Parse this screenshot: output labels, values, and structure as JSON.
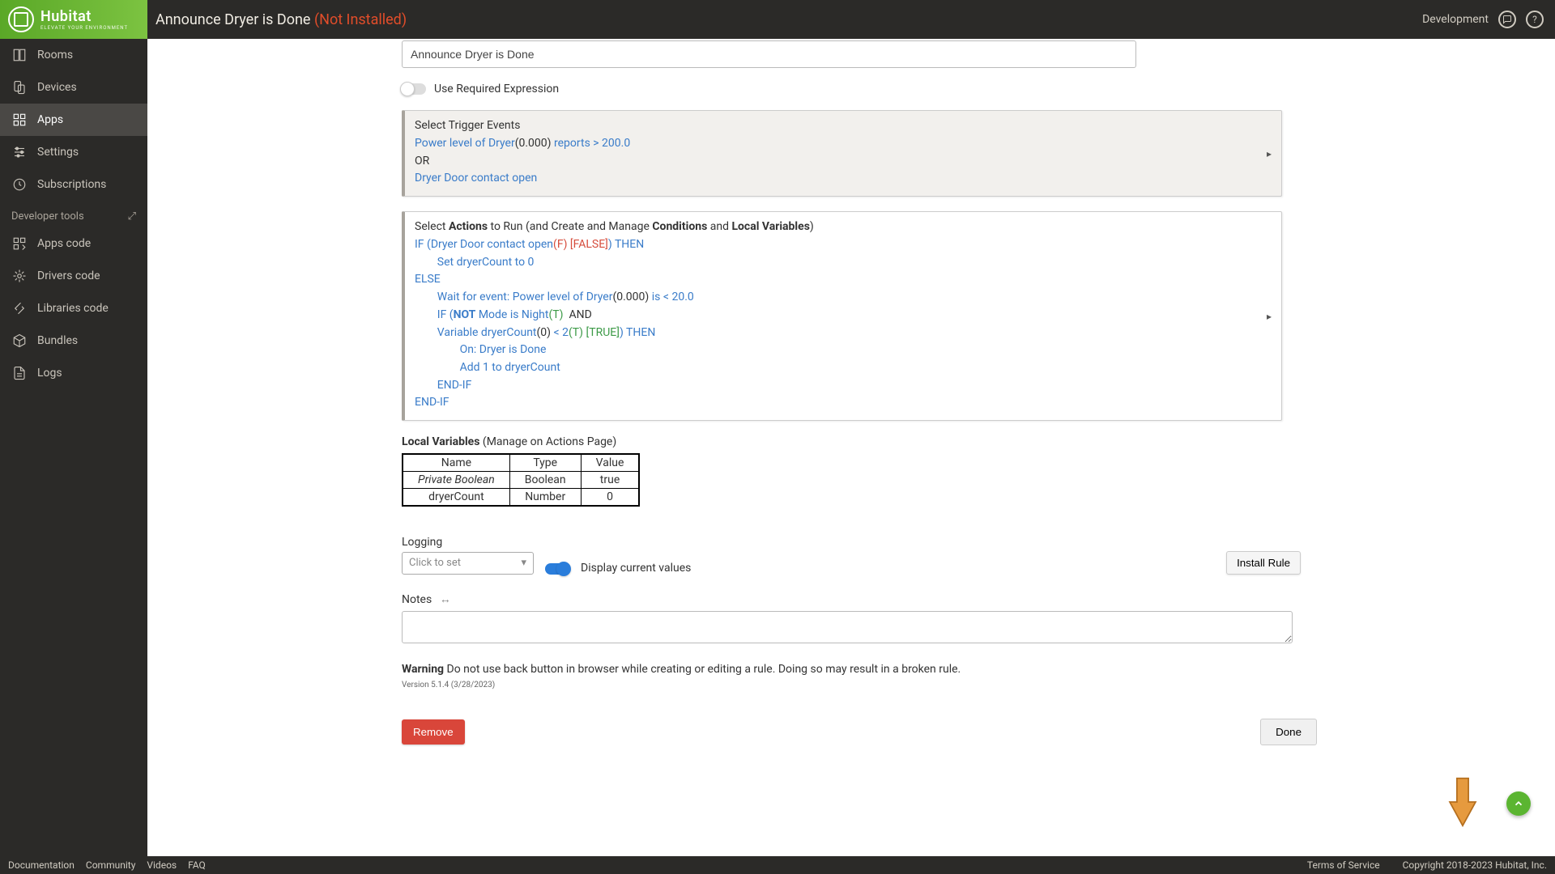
{
  "header": {
    "title": "Announce Dryer is Done",
    "status": "(Not Installed)",
    "env_label": "Development"
  },
  "logo": {
    "brand": "Hubitat",
    "tagline": "ELEVATE YOUR ENVIRONMENT"
  },
  "sidebar": {
    "items": [
      {
        "label": "Rooms",
        "icon": "rooms"
      },
      {
        "label": "Devices",
        "icon": "devices"
      },
      {
        "label": "Apps",
        "icon": "apps",
        "active": true
      },
      {
        "label": "Settings",
        "icon": "settings"
      },
      {
        "label": "Subscriptions",
        "icon": "subscriptions"
      }
    ],
    "dev_section": "Developer tools",
    "dev_items": [
      {
        "label": "Apps code"
      },
      {
        "label": "Drivers code"
      },
      {
        "label": "Libraries code"
      },
      {
        "label": "Bundles"
      },
      {
        "label": "Logs"
      }
    ]
  },
  "rule": {
    "name": "Announce Dryer is Done",
    "use_required_expression_label": "Use Required Expression",
    "triggers": {
      "title": "Select Trigger Events",
      "line1_a": "Power level of Dryer",
      "line1_b": "(0.000)",
      "line1_c": " reports > 200.0",
      "or": "OR",
      "line2": "Dryer Door contact open"
    },
    "actions": {
      "prefix": "Select ",
      "bold1": "Actions",
      "mid1": " to Run (and Create and Manage ",
      "bold2": "Conditions",
      "mid2": " and ",
      "bold3": "Local Variables",
      "suffix": ")",
      "l1_a": "IF (",
      "l1_b": "Dryer Door contact open",
      "l1_c": "(F)",
      "l1_d": " [FALSE]",
      "l1_e": ") ",
      "l1_f": "THEN",
      "l2": "Set dryerCount to 0",
      "l3": "ELSE",
      "l4_a": "Wait for event: Power level of Dryer",
      "l4_b": "(0.000)",
      "l4_c": " is < 20.0",
      "l5_a": "IF (",
      "l5_b": "NOT",
      "l5_c": " Mode is Night",
      "l5_d": "(T)",
      "l5_e": "  AND",
      "l6_a": "Variable dryerCount",
      "l6_b": "(0)",
      "l6_c": " < ",
      "l6_d": "2",
      "l6_e": "(T)",
      "l6_f": " [TRUE]",
      "l6_g": ") ",
      "l6_h": "THEN",
      "l7": "On: Dryer is Done",
      "l8": "Add 1 to dryerCount",
      "l9": "END-IF",
      "l10": "END-IF"
    },
    "local_vars": {
      "title_bold": "Local Variables",
      "title_rest": " (Manage on Actions Page)",
      "headers": [
        "Name",
        "Type",
        "Value"
      ],
      "rows": [
        {
          "name": "Private Boolean",
          "type": "Boolean",
          "value": "true",
          "italic": true
        },
        {
          "name": "dryerCount",
          "type": "Number",
          "value": "0",
          "italic": false
        }
      ]
    },
    "logging_label": "Logging",
    "logging_placeholder": "Click to set",
    "display_current_label": "Display current values",
    "install_btn": "Install Rule",
    "notes_label": "Notes",
    "warning_bold": "Warning",
    "warning_text": " Do not use back button in browser while creating or editing a rule. Doing so may result in a broken rule.",
    "version": "Version 5.1.4 (3/28/2023)",
    "remove_btn": "Remove",
    "done_btn": "Done"
  },
  "footer": {
    "left": [
      "Documentation",
      "Community",
      "Videos",
      "FAQ"
    ],
    "right": [
      "Terms of Service",
      "Copyright 2018-2023 Hubitat, Inc."
    ]
  }
}
